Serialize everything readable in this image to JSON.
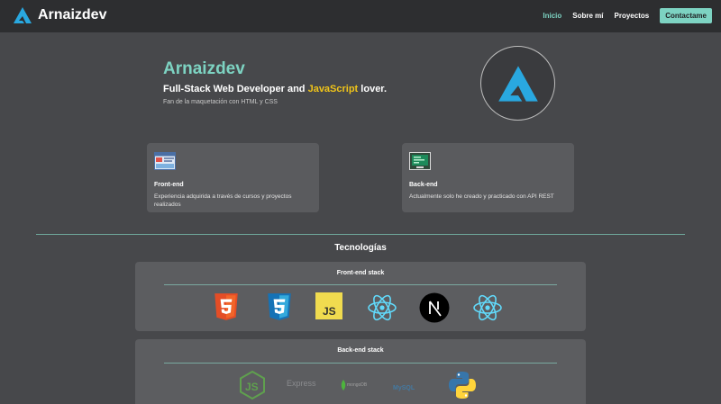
{
  "header": {
    "brand": "Arnaizdev",
    "nav": {
      "inicio": "Inicio",
      "sobre_mi": "Sobre mí",
      "proyectos": "Proyectos",
      "contactame": "Contactame"
    }
  },
  "hero": {
    "name": "Arnaizdev",
    "subtitle_prefix": "Full-Stack Web Developer and",
    "subtitle_highlight": "JavaScript",
    "subtitle_suffix": "lover.",
    "description": "Fan de la maquetación con HTML y CSS"
  },
  "cards": {
    "frontend": {
      "title": "Front-end",
      "text": "Experiencia adquirida a través de cursos y proyectos realizados"
    },
    "backend": {
      "title": "Back-end",
      "text": "Actualmente solo he creado y practicado con API REST"
    }
  },
  "technologies": {
    "title": "Tecnologías",
    "frontend_stack": {
      "title": "Front-end stack",
      "icons": [
        "html5-icon",
        "css3-icon",
        "javascript-icon",
        "react-icon",
        "nextjs-icon",
        "react-icon"
      ]
    },
    "backend_stack": {
      "title": "Back-end stack",
      "icons": [
        "nodejs-icon",
        "express-icon",
        "mongodb-icon",
        "mysql-icon",
        "python-icon"
      ],
      "express_label": "Express",
      "mongodb_label": "mongoDB",
      "mysql_label": "MySQL"
    }
  },
  "colors": {
    "accent": "#7dd3c2",
    "highlight": "#f0c419",
    "background": "#47484b",
    "header": "#2d2e30"
  }
}
